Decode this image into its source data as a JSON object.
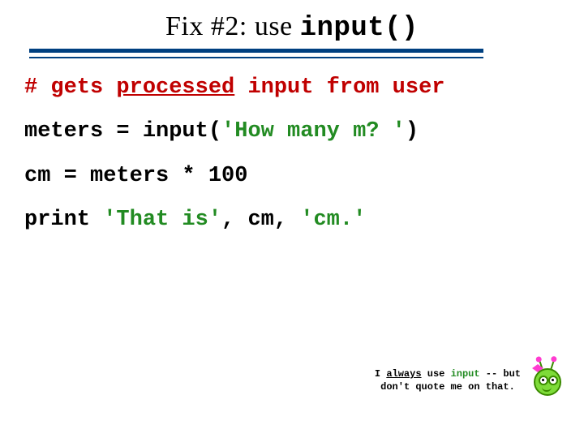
{
  "title": {
    "prefix": "Fix #2:  use ",
    "code": "input()"
  },
  "code": {
    "l1_hash": "# gets ",
    "l1_underlined": "processed",
    "l1_rest": " input from user",
    "l2_a": "meters = input(",
    "l2_str": "'How many m? '",
    "l2_b": ")",
    "l3": "cm = meters * 100",
    "l4_a": "print ",
    "l4_s1": "'That is'",
    "l4_b": ", cm, ",
    "l4_s2": "'cm.'"
  },
  "footnote": {
    "pre": "I ",
    "always": "always",
    "mid": " use ",
    "input": "input",
    "post1": " -- but",
    "line2": "don't quote me on that."
  }
}
